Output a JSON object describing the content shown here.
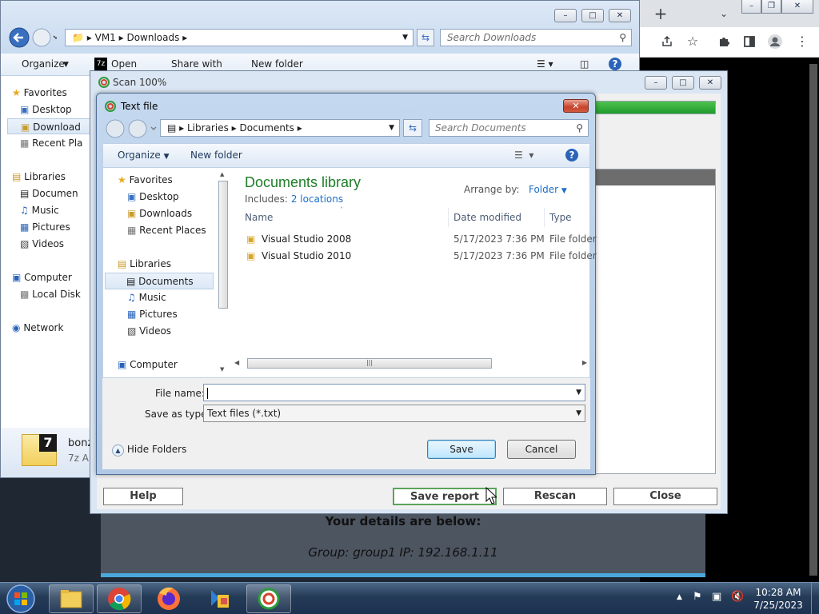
{
  "explorer": {
    "breadcrumb": [
      "VM1",
      "Downloads"
    ],
    "search_placeholder": "Search Downloads",
    "commands": [
      "Organize",
      "Open",
      "Share with",
      "New folder"
    ],
    "nav": {
      "favorites": "Favorites",
      "desktop": "Desktop",
      "downloads": "Download",
      "recent": "Recent Pla",
      "libraries": "Libraries",
      "documents": "Documen",
      "music": "Music",
      "pictures": "Pictures",
      "videos": "Videos",
      "computer": "Computer",
      "localdisk": "Local Disk",
      "network": "Network"
    },
    "status": {
      "name": "bonz",
      "type": "7z Ar"
    }
  },
  "scan": {
    "title": "Scan 100%",
    "progress": 1.0,
    "buttons": {
      "help": "Help",
      "save_report": "Save report",
      "rescan": "Rescan",
      "close": "Close"
    }
  },
  "page": {
    "line1": "Your details are below:",
    "line2": "Group: group1   IP: 192.168.1.11"
  },
  "dialog": {
    "title": "Text file",
    "breadcrumb": [
      "Libraries",
      "Documents"
    ],
    "search_placeholder": "Search Documents",
    "commands": {
      "organize": "Organize",
      "new_folder": "New folder"
    },
    "tree": {
      "favorites": "Favorites",
      "desktop": "Desktop",
      "downloads": "Downloads",
      "recent": "Recent Places",
      "libraries": "Libraries",
      "documents": "Documents",
      "music": "Music",
      "pictures": "Pictures",
      "videos": "Videos",
      "computer": "Computer"
    },
    "library_title": "Documents library",
    "includes_label": "Includes:",
    "includes_link": "2 locations",
    "arrange_label": "Arrange by:",
    "arrange_value": "Folder",
    "columns": {
      "name": "Name",
      "date": "Date modified",
      "type": "Type"
    },
    "files": [
      {
        "name": "Visual Studio 2008",
        "date": "5/17/2023 7:36 PM",
        "type": "File folder"
      },
      {
        "name": "Visual Studio 2010",
        "date": "5/17/2023 7:36 PM",
        "type": "File folder"
      }
    ],
    "filename_label": "File name:",
    "filename_value": "",
    "savetype_label": "Save as type:",
    "savetype_value": "Text files (*.txt)",
    "hide_folders": "Hide Folders",
    "save": "Save",
    "cancel": "Cancel"
  },
  "taskbar": {
    "time": "10:28 AM",
    "date": "7/25/2023"
  },
  "colors": {
    "library_title": "#1e7c28",
    "link": "#1c6fc9",
    "progress": "#1f9b2c"
  }
}
